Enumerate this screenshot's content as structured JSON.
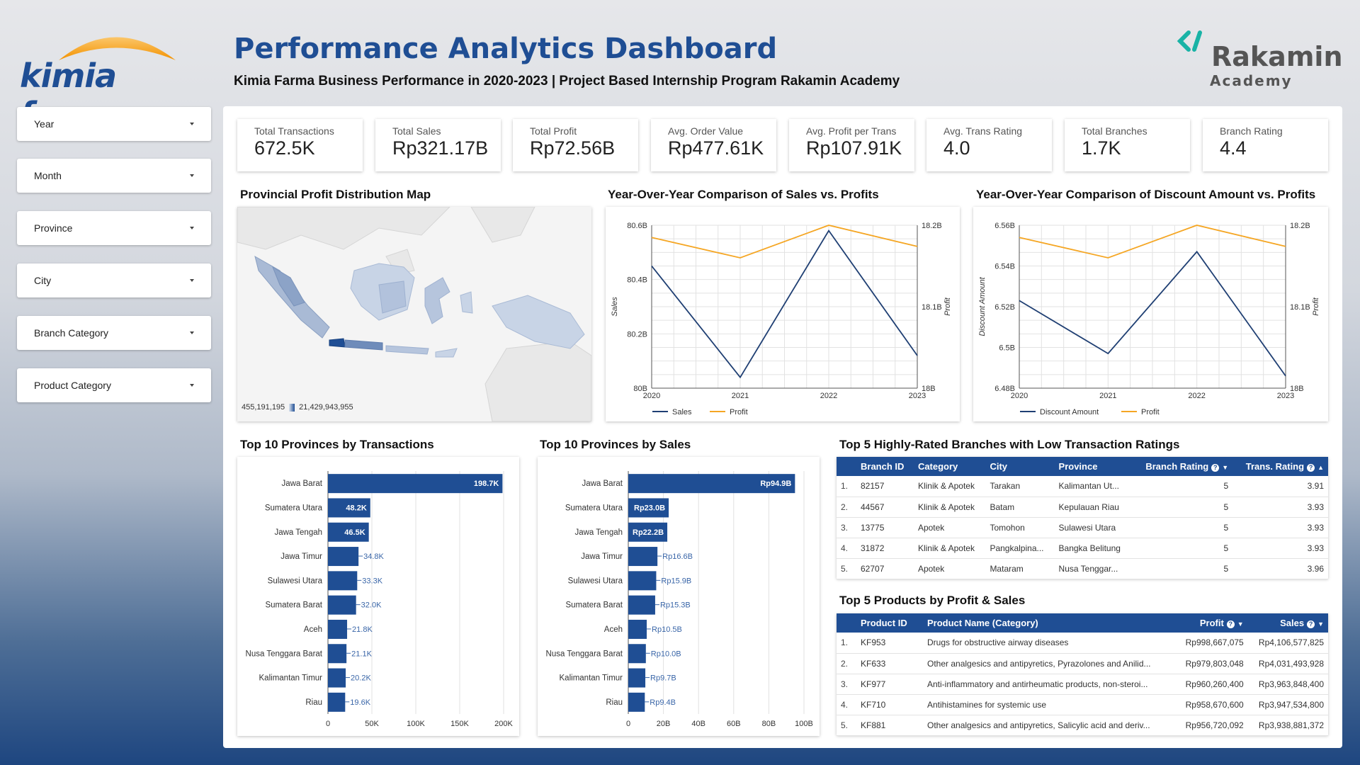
{
  "header": {
    "logo_text": "kimia farma",
    "title": "Performance Analytics Dashboard",
    "subtitle": "Kimia Farma Business Performance in 2020-2023 | Project Based Internship Program Rakamin Academy",
    "rakamin_name": "Rakamin",
    "rakamin_sub": "Academy"
  },
  "filters": [
    "Year",
    "Month",
    "Province",
    "City",
    "Branch Category",
    "Product Category"
  ],
  "kpis": [
    {
      "label": "Total Transactions",
      "value": "672.5K"
    },
    {
      "label": "Total Sales",
      "value": "Rp321.17B"
    },
    {
      "label": "Total Profit",
      "value": "Rp72.56B"
    },
    {
      "label": "Avg. Order Value",
      "value": "Rp477.61K"
    },
    {
      "label": "Avg. Profit per Trans",
      "value": "Rp107.91K"
    },
    {
      "label": "Avg. Trans Rating",
      "value": "4.0"
    },
    {
      "label": "Total Branches",
      "value": "1.7K"
    },
    {
      "label": "Branch Rating",
      "value": "4.4"
    }
  ],
  "map": {
    "title": "Provincial Profit Distribution Map",
    "legend_min": "455,191,195",
    "legend_max": "21,429,943,955"
  },
  "chart_data": [
    {
      "type": "line",
      "title": "Year-Over-Year Comparison of Sales vs. Profits",
      "x": [
        "2020",
        "2021",
        "2022",
        "2023"
      ],
      "ylabel": "Sales",
      "y2label": "Profit",
      "ylim": [
        80,
        80.6
      ],
      "y2lim": [
        18,
        18.2
      ],
      "yticks": [
        "80B",
        "80.2B",
        "80.4B",
        "80.6B"
      ],
      "y2ticks": [
        "18B",
        "18.1B",
        "18.2B"
      ],
      "series": [
        {
          "name": "Sales",
          "axis": "left",
          "values": [
            80.45,
            80.04,
            80.58,
            80.12
          ],
          "color": "#1f3f73"
        },
        {
          "name": "Profit",
          "axis": "right",
          "values": [
            18.185,
            18.16,
            18.2,
            18.174
          ],
          "color": "#f5a623"
        }
      ]
    },
    {
      "type": "line",
      "title": "Year-Over-Year Comparison of Discount Amount vs. Profits",
      "x": [
        "2020",
        "2021",
        "2022",
        "2023"
      ],
      "ylabel": "Discount Amount",
      "y2label": "Profit",
      "ylim": [
        6.48,
        6.56
      ],
      "y2lim": [
        18,
        18.2
      ],
      "yticks": [
        "6.48B",
        "6.5B",
        "6.52B",
        "6.54B",
        "6.56B"
      ],
      "y2ticks": [
        "18B",
        "18.1B",
        "18.2B"
      ],
      "series": [
        {
          "name": "Discount Amount",
          "axis": "left",
          "values": [
            6.523,
            6.497,
            6.547,
            6.486
          ],
          "color": "#1f3f73"
        },
        {
          "name": "Profit",
          "axis": "right",
          "values": [
            18.185,
            18.16,
            18.2,
            18.174
          ],
          "color": "#f5a623"
        }
      ]
    },
    {
      "type": "bar",
      "title": "Top 10 Provinces by Transactions",
      "categories": [
        "Jawa Barat",
        "Sumatera Utara",
        "Jawa Tengah",
        "Jawa Timur",
        "Sulawesi Utara",
        "Sumatera Barat",
        "Aceh",
        "Nusa Tenggara Barat",
        "Kalimantan Timur",
        "Riau"
      ],
      "values": [
        198.7,
        48.2,
        46.5,
        34.8,
        33.3,
        32.0,
        21.8,
        21.1,
        20.2,
        19.6
      ],
      "labels": [
        "198.7K",
        "48.2K",
        "46.5K",
        "34.8K",
        "33.3K",
        "32.0K",
        "21.8K",
        "21.1K",
        "20.2K",
        "19.6K"
      ],
      "xlim": [
        0,
        200
      ],
      "xticks": [
        "0",
        "50K",
        "100K",
        "150K",
        "200K"
      ]
    },
    {
      "type": "bar",
      "title": "Top 10 Provinces by Sales",
      "categories": [
        "Jawa Barat",
        "Sumatera Utara",
        "Jawa Tengah",
        "Jawa Timur",
        "Sulawesi Utara",
        "Sumatera Barat",
        "Aceh",
        "Nusa Tenggara Barat",
        "Kalimantan Timur",
        "Riau"
      ],
      "values": [
        94.9,
        23.0,
        22.2,
        16.6,
        15.9,
        15.3,
        10.5,
        10.0,
        9.7,
        9.4
      ],
      "labels": [
        "Rp94.9B",
        "Rp23.0B",
        "Rp22.2B",
        "Rp16.6B",
        "Rp15.9B",
        "Rp15.3B",
        "Rp10.5B",
        "Rp10.0B",
        "Rp9.7B",
        "Rp9.4B"
      ],
      "xlim": [
        0,
        100
      ],
      "xticks": [
        "0",
        "20B",
        "40B",
        "60B",
        "80B",
        "100B"
      ]
    }
  ],
  "branches": {
    "title": "Top 5 Highly-Rated Branches with Low Transaction Ratings",
    "headers": [
      "Branch ID",
      "Category",
      "City",
      "Province",
      "Branch Rating",
      "Trans. Rating"
    ],
    "rows": [
      [
        "1.",
        "82157",
        "Klinik & Apotek",
        "Tarakan",
        "Kalimantan Ut...",
        "5",
        "3.91"
      ],
      [
        "2.",
        "44567",
        "Klinik & Apotek",
        "Batam",
        "Kepulauan Riau",
        "5",
        "3.93"
      ],
      [
        "3.",
        "13775",
        "Apotek",
        "Tomohon",
        "Sulawesi Utara",
        "5",
        "3.93"
      ],
      [
        "4.",
        "31872",
        "Klinik & Apotek",
        "Pangkalpina...",
        "Bangka Belitung",
        "5",
        "3.93"
      ],
      [
        "5.",
        "62707",
        "Apotek",
        "Mataram",
        "Nusa Tenggar...",
        "5",
        "3.96"
      ]
    ]
  },
  "products": {
    "title": "Top 5 Products by Profit & Sales",
    "headers": [
      "Product ID",
      "Product Name (Category)",
      "Profit",
      "Sales"
    ],
    "rows": [
      [
        "1.",
        "KF953",
        "Drugs for obstructive airway diseases",
        "Rp998,667,075",
        "Rp4,106,577,825"
      ],
      [
        "2.",
        "KF633",
        "Other analgesics and antipyretics, Pyrazolones and Anilid...",
        "Rp979,803,048",
        "Rp4,031,493,928"
      ],
      [
        "3.",
        "KF977",
        "Anti-inflammatory and antirheumatic products, non-steroi...",
        "Rp960,260,400",
        "Rp3,963,848,400"
      ],
      [
        "4.",
        "KF710",
        "Antihistamines for systemic use",
        "Rp958,670,600",
        "Rp3,947,534,800"
      ],
      [
        "5.",
        "KF881",
        "Other analgesics and antipyretics, Salicylic acid and deriv...",
        "Rp956,720,092",
        "Rp3,938,881,372"
      ]
    ]
  }
}
